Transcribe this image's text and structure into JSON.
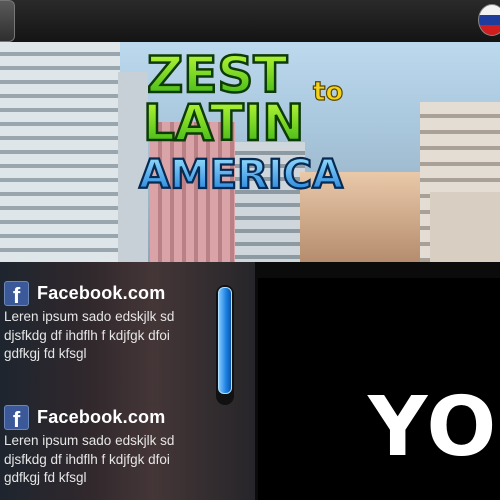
{
  "logo": {
    "line1": "ZEST",
    "to": "to",
    "line2": "LATIN",
    "line3": "AMERICA"
  },
  "feed": {
    "items": [
      {
        "icon": "facebook-icon",
        "title": "Facebook.com",
        "body": "Leren ipsum sado edskjlk sd djsfkdg df ihdflh f kdjfgk dfoi gdfkgj fd kfsgl"
      },
      {
        "icon": "facebook-icon",
        "title": "Facebook.com",
        "body": "Leren ipsum sado edskjlk sd djsfkdg df ihdflh f kdjfgk dfoi gdfkgj fd kfsgl"
      }
    ]
  },
  "video": {
    "caption": "YO"
  },
  "colors": {
    "accent_blue": "#1b7fe0",
    "facebook_blue": "#3b5998",
    "logo_green": "#4fd12a",
    "logo_blue": "#2a9ee8"
  }
}
